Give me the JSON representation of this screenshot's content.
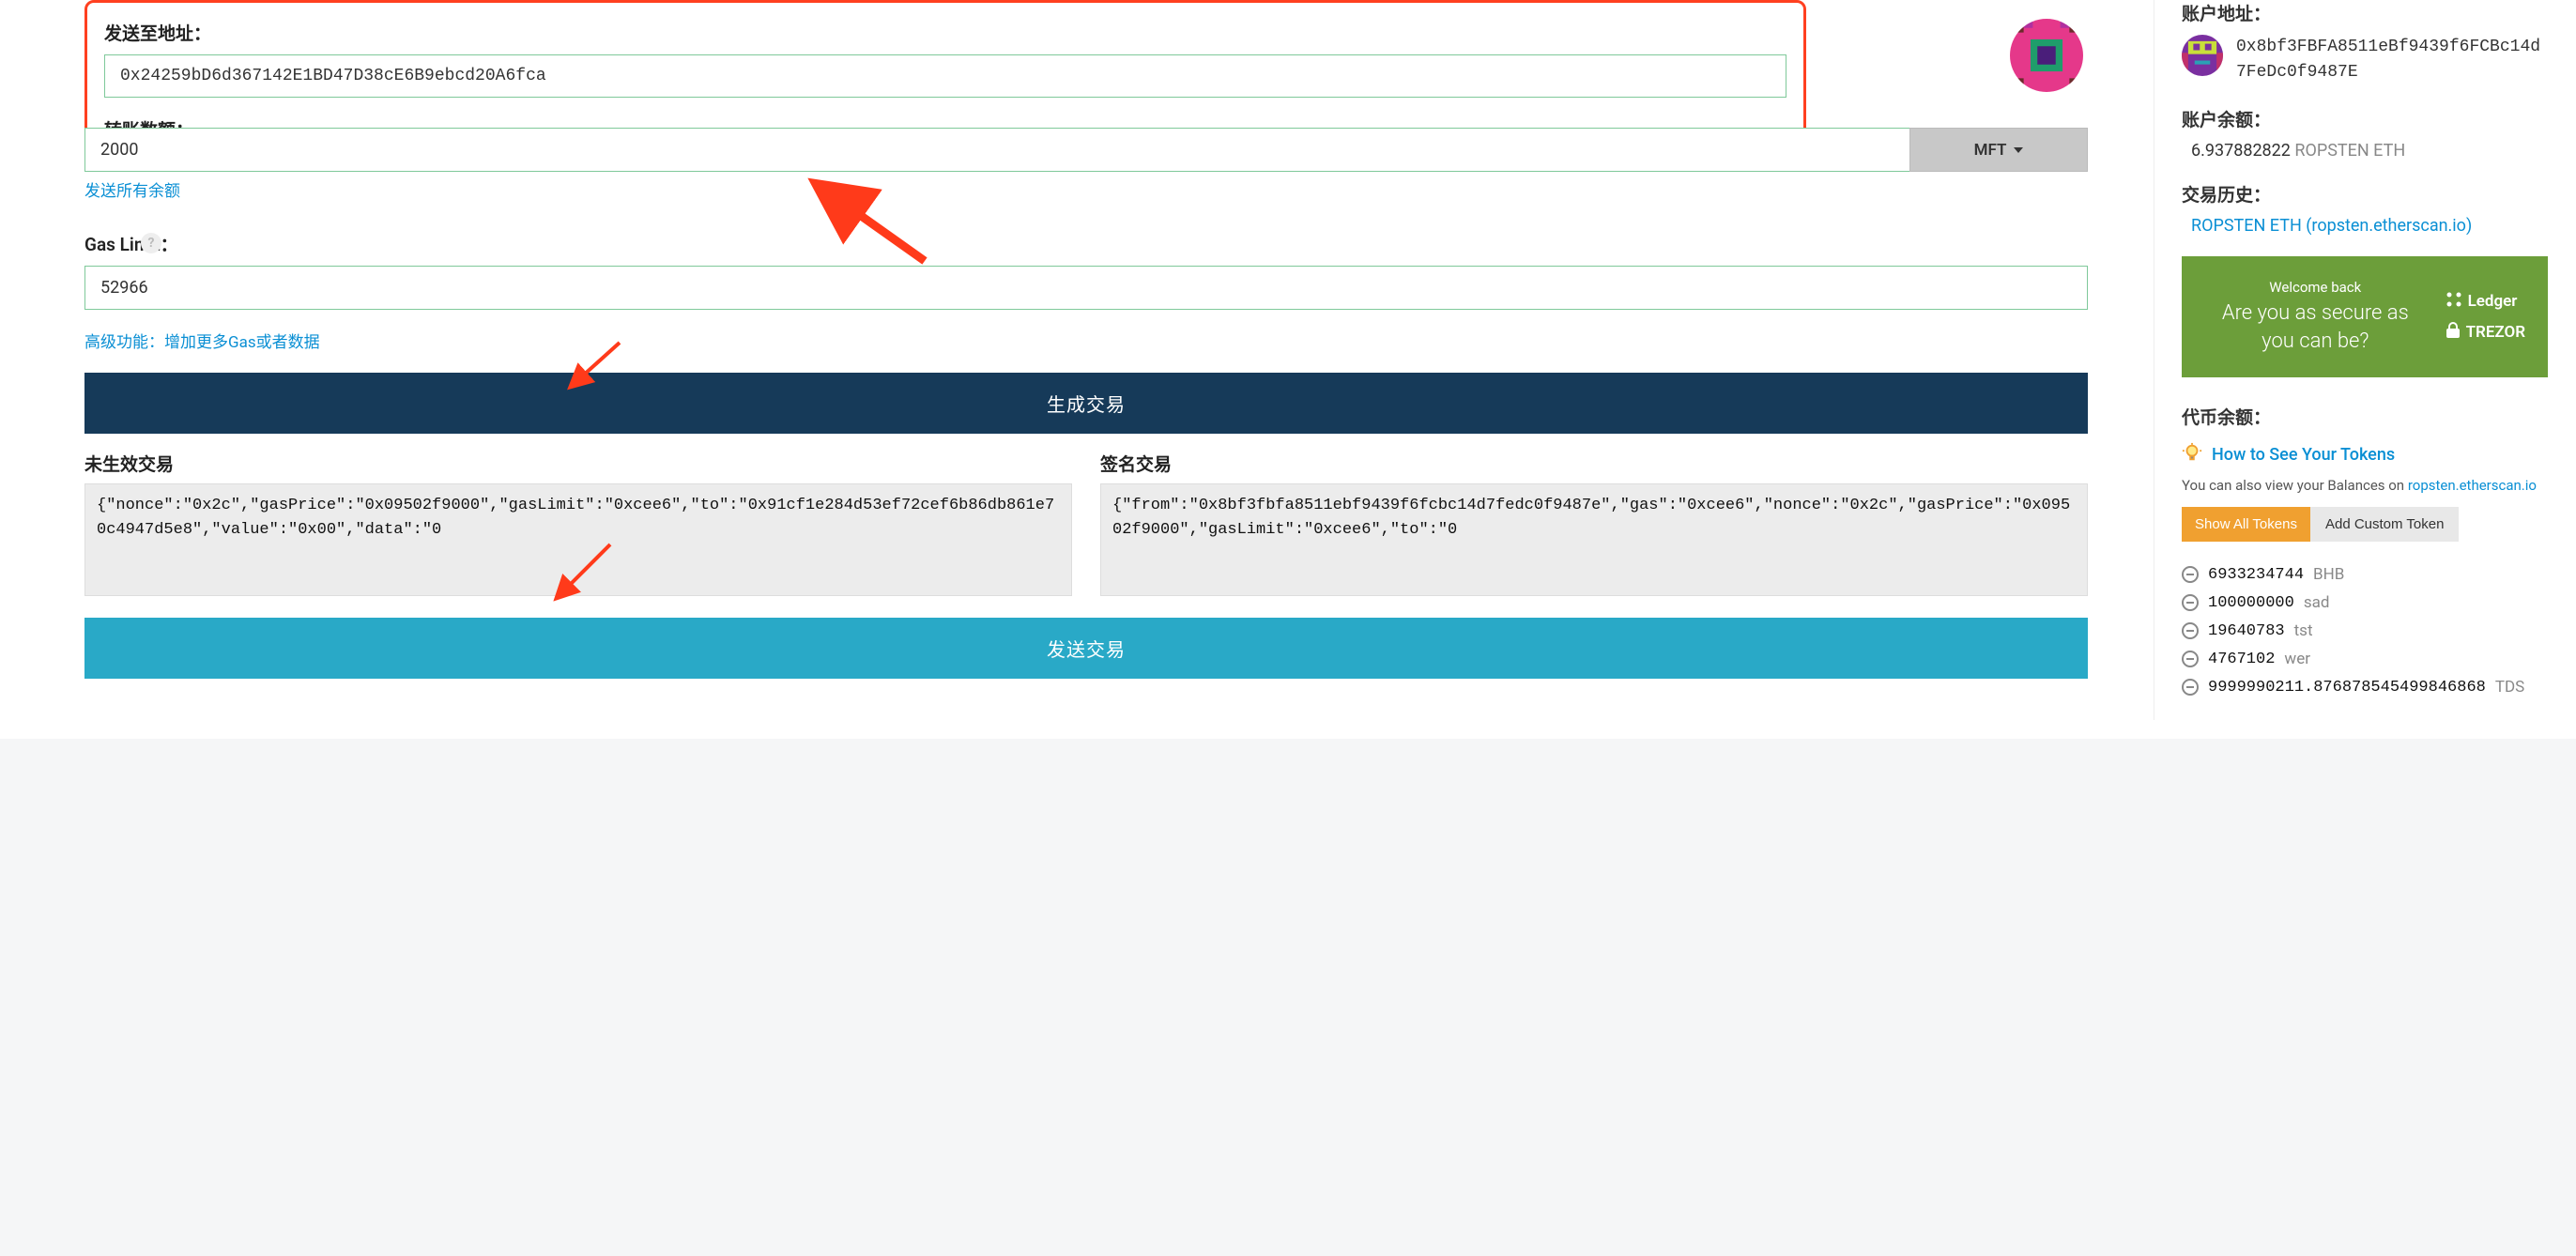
{
  "form": {
    "to_label": "发送至地址：",
    "to_value": "0x24259bD6d367142E1BD47D38cE6B9ebcd20A6fca",
    "amount_label": "转账数额：",
    "amount_value": "2000",
    "token": "MFT",
    "send_all": "发送所有余额",
    "gas_label": "Gas Limit：",
    "gas_value": "52966",
    "advanced_link": "高级功能：增加更多Gas或者数据",
    "generate_btn": "生成交易",
    "raw_label": "未生效交易",
    "raw_value": "{\"nonce\":\"0x2c\",\"gasPrice\":\"0x09502f9000\",\"gasLimit\":\"0xcee6\",\"to\":\"0x91cf1e284d53ef72cef6b86db861e70c4947d5e8\",\"value\":\"0x00\",\"data\":\"0",
    "signed_label": "签名交易",
    "signed_value": "{\"from\":\"0x8bf3fbfa8511ebf9439f6fcbc14d7fedc0f9487e\",\"gas\":\"0xcee6\",\"nonce\":\"0x2c\",\"gasPrice\":\"0x09502f9000\",\"gasLimit\":\"0xcee6\",\"to\":\"0",
    "send_btn": "发送交易"
  },
  "account": {
    "address_label": "账户地址：",
    "address": "0x8bf3FBFA8511eBf9439f6FCBc14d7FeDc0f9487E",
    "balance_label": "账户余额：",
    "balance_amount": "6.937882822",
    "balance_currency": "ROPSTEN ETH",
    "history_label": "交易历史：",
    "history_link": "ROPSTEN ETH (ropsten.etherscan.io)"
  },
  "banner": {
    "welcome": "Welcome back",
    "headline": "Are you as secure as you can be?",
    "ledger": "Ledger",
    "trezor": "TREZOR"
  },
  "tokens": {
    "header": "代币余额：",
    "howto": "How to See Your Tokens",
    "note_prefix": "You can also view your Balances on ",
    "note_link": "ropsten.etherscan.io",
    "show_all_btn": "Show All Tokens",
    "add_custom_btn": "Add Custom Token",
    "list": [
      {
        "amount": "6933234744",
        "symbol": "BHB"
      },
      {
        "amount": "100000000",
        "symbol": "sad"
      },
      {
        "amount": "19640783",
        "symbol": "tst"
      },
      {
        "amount": "4767102",
        "symbol": "wer"
      },
      {
        "amount": "9999990211.876878545499846868",
        "symbol": "TDS"
      }
    ]
  }
}
